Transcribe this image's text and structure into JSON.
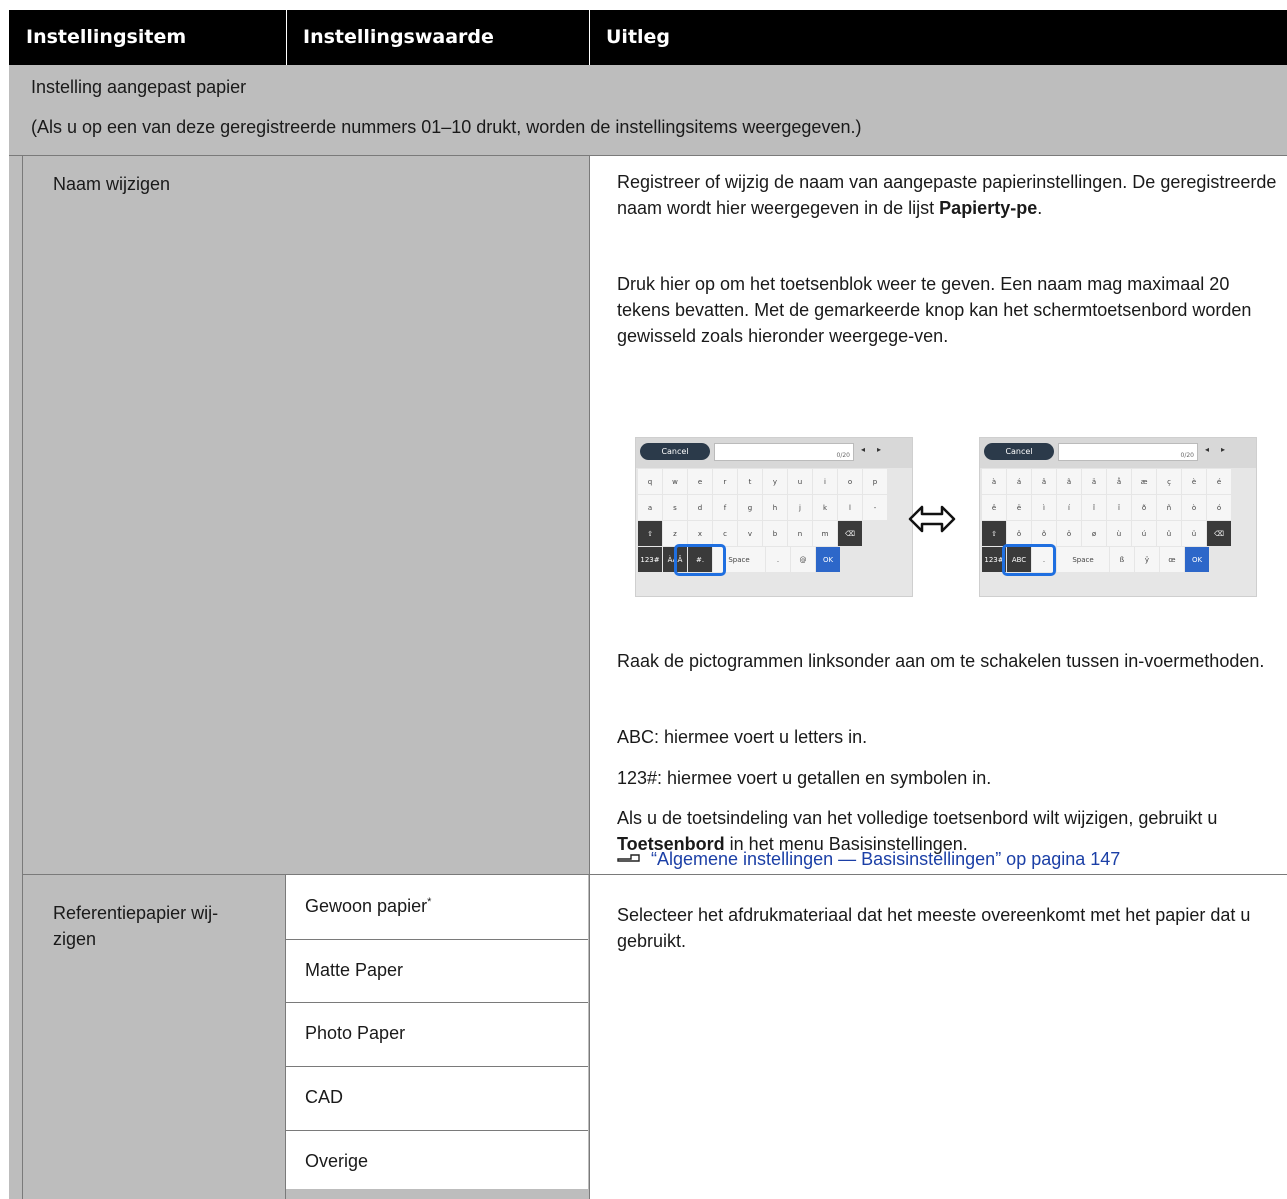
{
  "header": {
    "col1": "Instellingsitem",
    "col2": "Instellingswaarde",
    "col3": "Uitleg"
  },
  "group": {
    "title": "Instelling aangepast papier",
    "note": "(Als u op een van deze geregistreerde nummers 01–10 drukt, worden de instellingsitems weergegeven.)"
  },
  "row_name": {
    "item": "Naam wijzigen",
    "p1_a": "Registreer of wijzig de naam van aangepaste papierinstellingen. De geregistreerde naam wordt hier weergegeven in de lijst ",
    "p1_bold": "Papierty-pe",
    "p1_end": ".",
    "p2": "Druk hier op om het toetsenblok weer te geven. Een naam mag maximaal 20 tekens bevatten. Met de gemarkeerde knop kan het schermtoetsenbord worden gewisseld zoals hieronder weergege-ven.",
    "p3": "Raak de pictogrammen linksonder aan om te schakelen tussen in-voermethoden.",
    "p4": "ABC: hiermee voert u letters in.",
    "p5": "123#: hiermee voert u getallen en symbolen in.",
    "p6_a": "Als u de toetsindeling van het volledige toetsenbord wilt wijzigen, gebruikt u ",
    "p6_bold": "Toetsenbord",
    "p6_end": " in het menu Basisinstellingen.",
    "link": "“Algemene instellingen — Basisinstellingen” op pagina 147"
  },
  "keyboard_left": {
    "cancel": "Cancel",
    "counter": "0/20",
    "rows": [
      [
        "q",
        "w",
        "e",
        "r",
        "t",
        "y",
        "u",
        "i",
        "o",
        "p"
      ],
      [
        "a",
        "s",
        "d",
        "f",
        "g",
        "h",
        "j",
        "k",
        "l",
        "-"
      ],
      [
        "⇧",
        "z",
        "x",
        "c",
        "v",
        "b",
        "n",
        "m",
        "⌫"
      ],
      [
        "123#",
        "ÀÄÂ",
        "#.",
        "Space",
        ".",
        "@",
        "OK"
      ]
    ],
    "highlight": "ÀÄÂ"
  },
  "keyboard_right": {
    "cancel": "Cancel",
    "counter": "0/20",
    "rows": [
      [
        "à",
        "á",
        "â",
        "ã",
        "ä",
        "å",
        "æ",
        "ç",
        "è",
        "é"
      ],
      [
        "ê",
        "ë",
        "ì",
        "í",
        "î",
        "ï",
        "ð",
        "ñ",
        "ò",
        "ó"
      ],
      [
        "⇧",
        "ô",
        "õ",
        "ö",
        "ø",
        "ù",
        "ú",
        "û",
        "ü",
        "⌫"
      ],
      [
        "123#",
        "ABC",
        ".",
        "Space",
        "ß",
        "ÿ",
        "œ",
        "OK"
      ]
    ],
    "highlight": "ABC"
  },
  "row_ref": {
    "item": "Referentiepapier wij-zigen",
    "item_line1": "Referentiepapier wij-",
    "item_line2": "zigen",
    "values": [
      "Gewoon papier",
      "Matte Paper",
      "Photo Paper",
      "CAD",
      "Overige"
    ],
    "default_marker": "*",
    "desc": "Selecteer het afdrukmateriaal dat het meeste overeenkomt met het papier dat u gebruikt."
  },
  "colors": {
    "header_bg": "#000000",
    "gray": "#bdbdbd",
    "link": "#1b3fa6",
    "highlight": "#1f6fe0"
  },
  "icons": {
    "swap": "double-arrow-icon",
    "reference": "pointing-hand-icon"
  }
}
